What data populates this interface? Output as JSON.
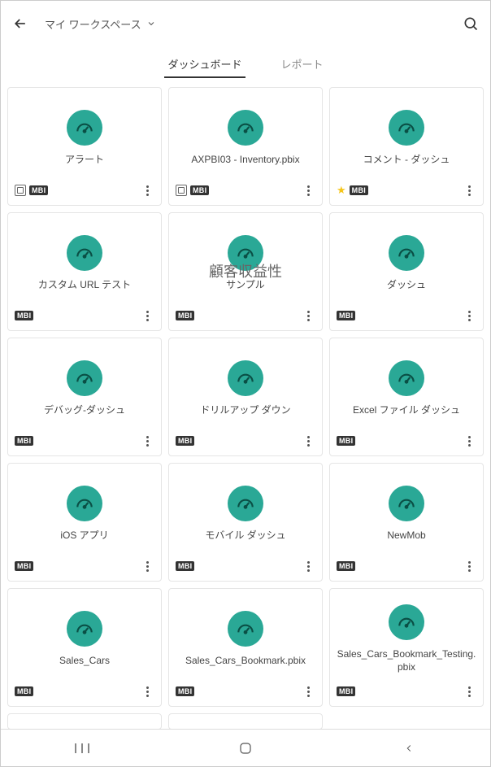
{
  "header": {
    "workspace_label": "マイ ワークスペース"
  },
  "tabs": [
    {
      "label": "ダッシュボード",
      "active": true
    },
    {
      "label": "レポート",
      "active": false
    }
  ],
  "cards": [
    {
      "title": "アラート",
      "badges": {
        "sensitivity": true,
        "mbi": true,
        "star": false
      },
      "big_text": null
    },
    {
      "title": "AXPBI03 - Inventory.pbix",
      "badges": {
        "sensitivity": true,
        "mbi": true,
        "star": false
      },
      "big_text": null
    },
    {
      "title": "コメント - ダッシュ",
      "badges": {
        "sensitivity": false,
        "mbi": true,
        "star": true
      },
      "big_text": null
    },
    {
      "title": "カスタム URL テスト",
      "badges": {
        "sensitivity": false,
        "mbi": true,
        "star": false
      },
      "big_text": null
    },
    {
      "title": "サンプル",
      "badges": {
        "sensitivity": false,
        "mbi": true,
        "star": false
      },
      "big_text": "顧客収益性"
    },
    {
      "title": "ダッシュ",
      "badges": {
        "sensitivity": false,
        "mbi": true,
        "star": false
      },
      "big_text": null
    },
    {
      "title": "デバッグ-ダッシュ",
      "badges": {
        "sensitivity": false,
        "mbi": true,
        "star": false
      },
      "big_text": null
    },
    {
      "title": "ドリルアップ ダウン",
      "badges": {
        "sensitivity": false,
        "mbi": true,
        "star": false
      },
      "big_text": null
    },
    {
      "title": "Excel ファイル ダッシュ",
      "badges": {
        "sensitivity": false,
        "mbi": true,
        "star": false
      },
      "big_text": null
    },
    {
      "title": "iOS アプリ",
      "badges": {
        "sensitivity": false,
        "mbi": true,
        "star": false
      },
      "big_text": null
    },
    {
      "title": "モバイル ダッシュ",
      "badges": {
        "sensitivity": false,
        "mbi": true,
        "star": false
      },
      "big_text": null
    },
    {
      "title": "NewMob",
      "badges": {
        "sensitivity": false,
        "mbi": true,
        "star": false
      },
      "big_text": null
    },
    {
      "title": "Sales_Cars",
      "badges": {
        "sensitivity": false,
        "mbi": true,
        "star": false
      },
      "big_text": null
    },
    {
      "title": "Sales_Cars_Bookmark.pbix",
      "badges": {
        "sensitivity": false,
        "mbi": true,
        "star": false
      },
      "big_text": null
    },
    {
      "title": "Sales_Cars_Bookmark_Testing.pbix",
      "badges": {
        "sensitivity": false,
        "mbi": true,
        "star": false
      },
      "big_text": null
    }
  ],
  "badge_label": "MBI"
}
